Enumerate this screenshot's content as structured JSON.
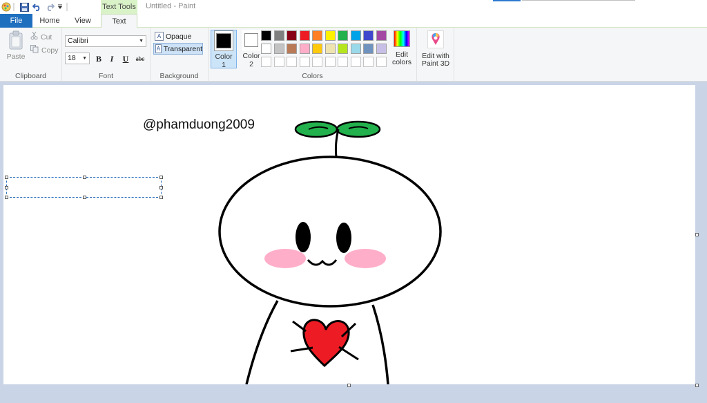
{
  "window": {
    "title": "Untitled - Paint",
    "context_tab_label": "Text Tools"
  },
  "quick_access": {
    "icons": [
      "paint-app-icon",
      "save-icon",
      "undo-icon",
      "redo-icon",
      "customize-qat-icon"
    ]
  },
  "tabs": [
    {
      "label": "File"
    },
    {
      "label": "Home"
    },
    {
      "label": "View"
    },
    {
      "label": "Text"
    }
  ],
  "clipboard": {
    "paste_label": "Paste",
    "cut_label": "Cut",
    "copy_label": "Copy",
    "group_label": "Clipboard"
  },
  "font": {
    "family": "Calibri",
    "size": "18",
    "bold": "B",
    "italic": "I",
    "underline": "U",
    "strikethrough": "abc",
    "group_label": "Font"
  },
  "background": {
    "opaque_label": "Opaque",
    "transparent_label": "Transparent",
    "selected": "Transparent",
    "group_label": "Background"
  },
  "colors": {
    "color1_label_line1": "Color",
    "color1_label_line2": "1",
    "color1_value": "#000000",
    "color2_label_line1": "Color",
    "color2_label_line2": "2",
    "color2_value": "#ffffff",
    "edit_colors_line1": "Edit",
    "edit_colors_line2": "colors",
    "group_label": "Colors",
    "palette": [
      "#000000",
      "#7f7f7f",
      "#880015",
      "#ed1c24",
      "#ff7f27",
      "#fff200",
      "#22b14c",
      "#00a2e8",
      "#3f48cc",
      "#a349a4",
      "#ffffff",
      "#c3c3c3",
      "#b97a57",
      "#ffaec9",
      "#ffc90e",
      "#efe4b0",
      "#b5e61d",
      "#99d9ea",
      "#7092be",
      "#c8bfe7",
      "#ffffff",
      "#ffffff",
      "#ffffff",
      "#ffffff",
      "#ffffff",
      "#ffffff",
      "#ffffff",
      "#ffffff",
      "#ffffff",
      "#ffffff"
    ]
  },
  "paint3d": {
    "line1": "Edit with",
    "line2": "Paint 3D"
  },
  "canvas": {
    "text": "@phamduong2009"
  }
}
